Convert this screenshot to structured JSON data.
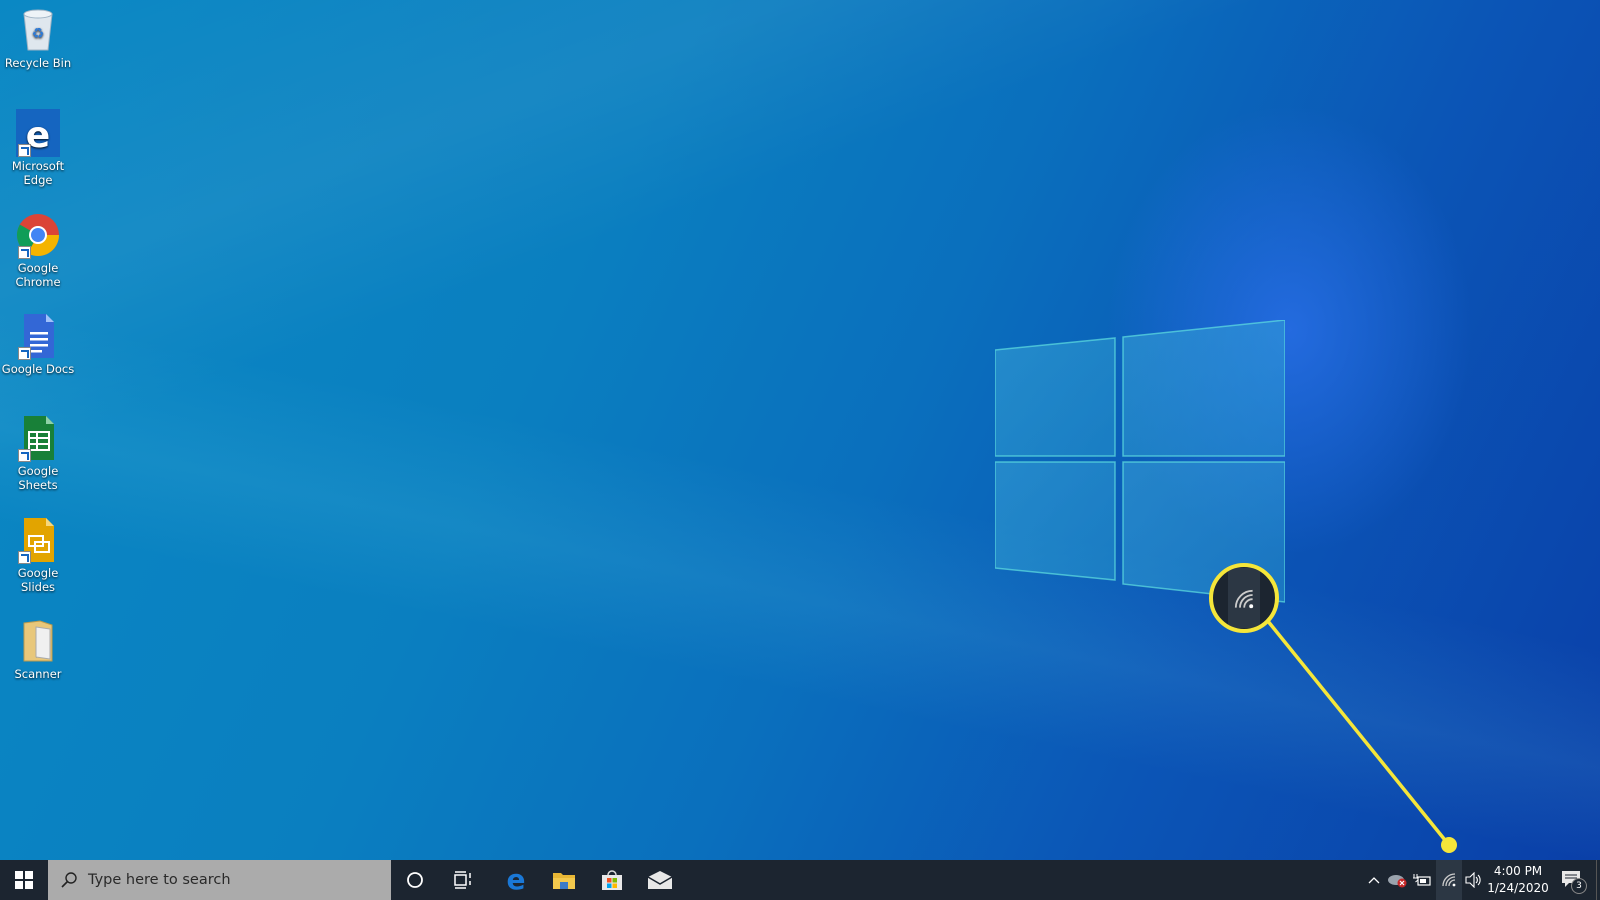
{
  "desktop": {
    "icons": [
      {
        "name": "recycle-bin",
        "label": "Recycle Bin",
        "shortcut": false
      },
      {
        "name": "microsoft-edge",
        "label": "Microsoft Edge",
        "shortcut": true
      },
      {
        "name": "google-chrome",
        "label": "Google Chrome",
        "shortcut": true
      },
      {
        "name": "google-docs",
        "label": "Google Docs",
        "shortcut": true
      },
      {
        "name": "google-sheets",
        "label": "Google Sheets",
        "shortcut": true
      },
      {
        "name": "google-slides",
        "label": "Google Slides",
        "shortcut": true
      },
      {
        "name": "scanner",
        "label": "Scanner",
        "shortcut": false
      }
    ]
  },
  "taskbar": {
    "start_icon": "windows-start-icon",
    "search_placeholder": "Type here to search",
    "pinned": [
      {
        "name": "cortana",
        "icon": "circle-icon"
      },
      {
        "name": "task-view",
        "icon": "task-view-icon"
      },
      {
        "name": "edge",
        "icon": "edge-icon"
      },
      {
        "name": "file-explorer",
        "icon": "folder-icon"
      },
      {
        "name": "microsoft-store",
        "icon": "store-bag-icon"
      },
      {
        "name": "mail",
        "icon": "mail-icon"
      }
    ],
    "tray": {
      "overflow_icon": "chevron-up-icon",
      "onedrive_icon": "cloud-error-icon",
      "battery_icon": "battery-charging-icon",
      "network_icon": "wifi-icon",
      "volume_icon": "speaker-icon",
      "time": "4:00 PM",
      "date": "1/24/2020",
      "notifications_count": "3"
    }
  },
  "annotation": {
    "type": "callout-magnifier",
    "target": "network-wifi-icon",
    "color": "#f5e63a"
  }
}
